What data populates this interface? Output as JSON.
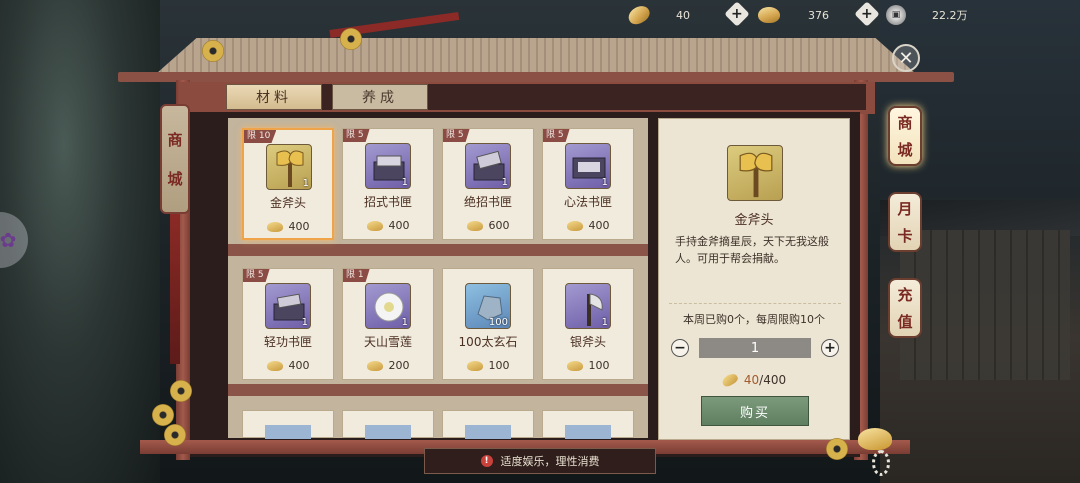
{
  "currencies": [
    {
      "icon": "gold-leaf-icon",
      "value": "40"
    },
    {
      "icon": "gold-ingot-icon",
      "value": "376"
    },
    {
      "icon": "copper-coin-icon",
      "value": "22.2万"
    }
  ],
  "tabs": [
    {
      "label": "材料",
      "active": true
    },
    {
      "label": "养成",
      "active": false
    }
  ],
  "left_plaque": {
    "chars": [
      "商",
      "城"
    ]
  },
  "side_tabs": [
    {
      "chars": [
        "商",
        "城"
      ],
      "active": true
    },
    {
      "chars": [
        "月",
        "卡"
      ],
      "active": false
    },
    {
      "chars": [
        "充",
        "值"
      ],
      "active": false
    }
  ],
  "items": [
    {
      "limit": "限 10",
      "name": "金斧头",
      "qty": "1",
      "price": "400",
      "icon": "gold-axe-icon",
      "selected": true
    },
    {
      "limit": "限 5",
      "name": "招式书匣",
      "qty": "1",
      "price": "400",
      "icon": "book-box-icon",
      "selected": false
    },
    {
      "limit": "限 5",
      "name": "绝招书匣",
      "qty": "1",
      "price": "600",
      "icon": "book-box-icon",
      "selected": false
    },
    {
      "limit": "限 5",
      "name": "心法书匣",
      "qty": "1",
      "price": "400",
      "icon": "book-box-icon",
      "selected": false
    },
    {
      "limit": "限 5",
      "name": "轻功书匣",
      "qty": "1",
      "price": "400",
      "icon": "book-box-icon",
      "selected": false
    },
    {
      "limit": "限 1",
      "name": "天山雪莲",
      "qty": "1",
      "price": "200",
      "icon": "snow-lotus-icon",
      "selected": false
    },
    {
      "limit": "",
      "name": "100太玄石",
      "qty": "100",
      "price": "100",
      "icon": "xuan-stone-icon",
      "selected": false
    },
    {
      "limit": "",
      "name": "银斧头",
      "qty": "1",
      "price": "100",
      "icon": "silver-axe-icon",
      "selected": false
    }
  ],
  "detail": {
    "name": "金斧头",
    "icon": "gold-axe-icon",
    "description": "手持金斧摘星辰，天下无我这般人。可用于帮会捐献。",
    "limit_info": "本周已购0个，每周限购10个",
    "quantity": "1",
    "cost_current": "40",
    "cost_total": "/400",
    "buy_label": "购买"
  },
  "notice": "适度娱乐，理性消费",
  "colors": {
    "accent_red": "#8b4c3f",
    "buy_green": "#5f7f61",
    "selected_orange": "#f0a44a"
  }
}
